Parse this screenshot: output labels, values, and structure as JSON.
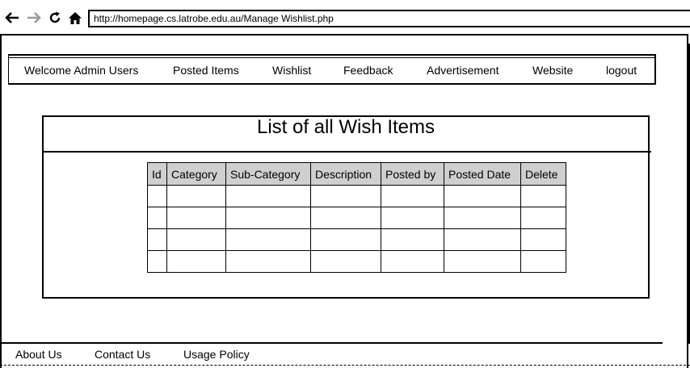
{
  "browser": {
    "url": "http://homepage.cs.latrobe.edu.au/Manage Wishlist.php",
    "icons": [
      "back-arrow-icon",
      "forward-arrow-icon",
      "reload-icon",
      "home-icon"
    ]
  },
  "menu": {
    "items": [
      "Welcome Admin Users",
      "Posted Items",
      "Wishlist",
      "Feedback",
      "Advertisement",
      "Website",
      "logout"
    ]
  },
  "content": {
    "title": "List of all Wish Items"
  },
  "table": {
    "headers": [
      "Id",
      "Category",
      "Sub-Category",
      "Description",
      "Posted by",
      "Posted Date",
      "Delete"
    ],
    "rows": [
      [
        "",
        "",
        "",
        "",
        "",
        "",
        ""
      ],
      [
        "",
        "",
        "",
        "",
        "",
        "",
        ""
      ],
      [
        "",
        "",
        "",
        "",
        "",
        "",
        ""
      ],
      [
        "",
        "",
        "",
        "",
        "",
        "",
        ""
      ]
    ]
  },
  "footer": {
    "items": [
      "About Us",
      "Contact Us",
      "Usage Policy"
    ]
  }
}
